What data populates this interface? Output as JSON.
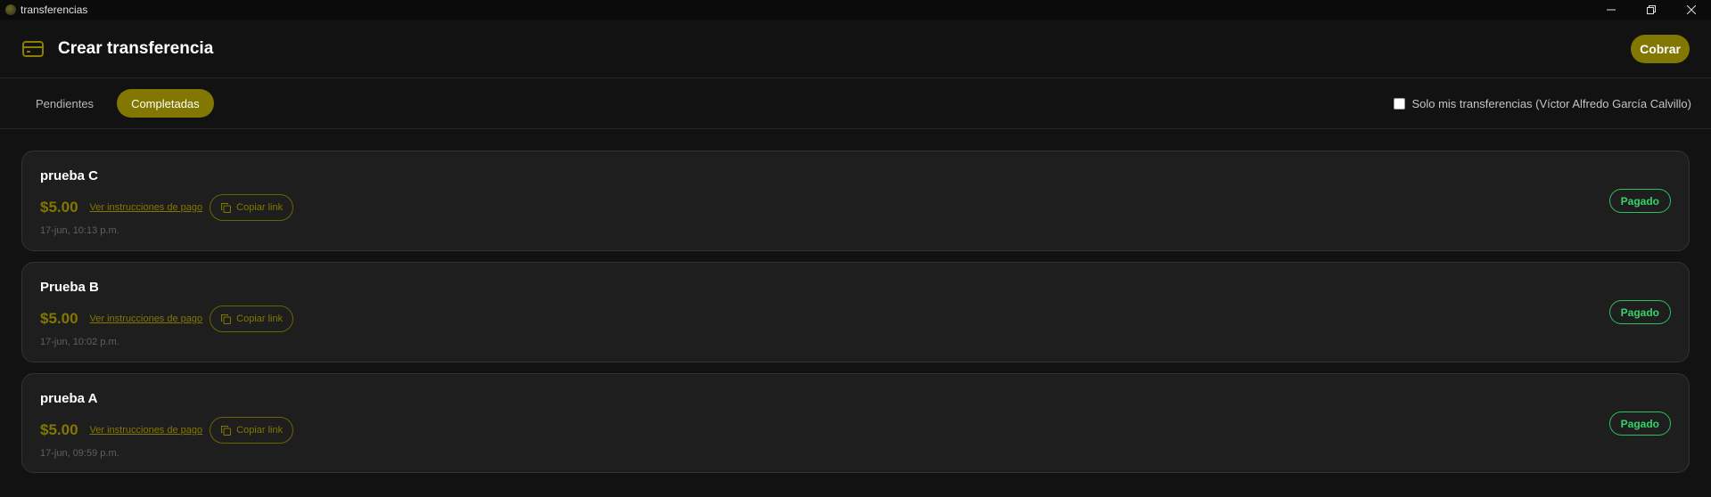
{
  "window": {
    "title": "transferencias",
    "controls": [
      "minimize-icon",
      "restore-icon",
      "close-icon"
    ]
  },
  "header": {
    "icon": "card-icon",
    "title": "Crear transferencia",
    "action_label": "Cobrar"
  },
  "tabs": [
    {
      "label": "Pendientes",
      "active": false
    },
    {
      "label": "Completadas",
      "active": true
    }
  ],
  "filter": {
    "label": "Solo mis transferencias (Víctor Alfredo García Calvillo)",
    "checked": false
  },
  "transfers": [
    {
      "title": "prueba C",
      "amount": "$5.00",
      "instructions_label": "Ver instrucciones de pago",
      "copy_label": "Copiar link",
      "date": "17-jun, 10:13 p.m.",
      "status": "Pagado"
    },
    {
      "title": "Prueba B",
      "amount": "$5.00",
      "instructions_label": "Ver instrucciones de pago",
      "copy_label": "Copiar link",
      "date": "17-jun, 10:02 p.m.",
      "status": "Pagado"
    },
    {
      "title": "prueba A",
      "amount": "$5.00",
      "instructions_label": "Ver instrucciones de pago",
      "copy_label": "Copiar link",
      "date": "17-jun, 09:59 p.m.",
      "status": "Pagado"
    }
  ],
  "colors": {
    "accent": "#827700",
    "status_paid": "#36d36a",
    "background": "#121212",
    "card": "#1e1e1e"
  }
}
